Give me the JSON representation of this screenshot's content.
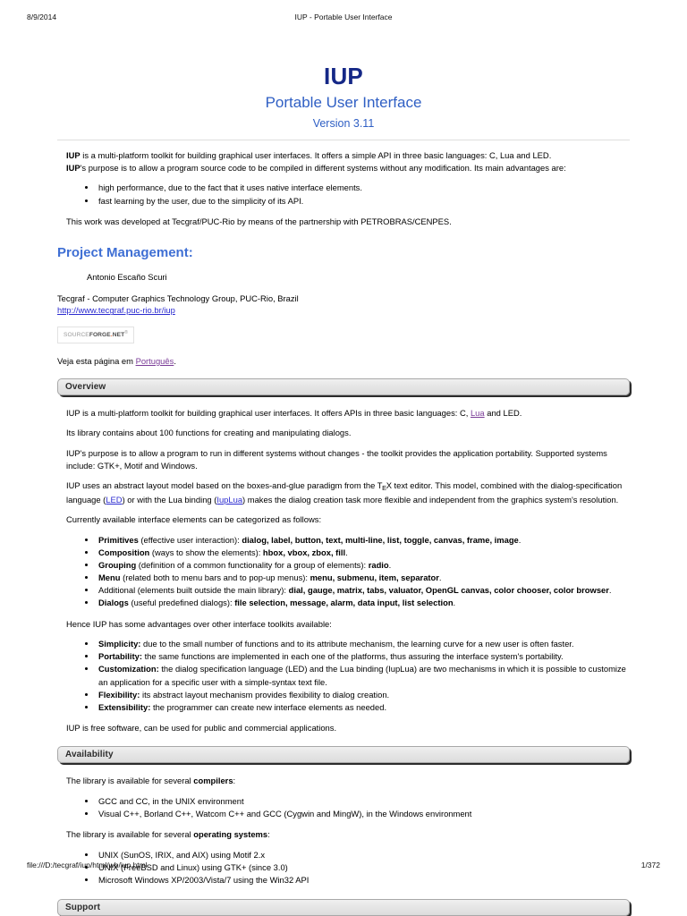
{
  "print_header": {
    "date": "8/9/2014",
    "title": "IUP - Portable User Interface"
  },
  "print_footer": {
    "url": "file:///D:/tecgraf/iup/html/wb/iup.html",
    "page": "1/372"
  },
  "title_block": {
    "title": "IUP",
    "subtitle": "Portable User Interface",
    "version": "Version 3.11",
    "title_color": "#152887",
    "subtitle_color": "#2f5fc4"
  },
  "intro": {
    "para1_bold": "IUP",
    "para1_rest": " is a multi-platform toolkit for building graphical user interfaces. It offers a simple API in three basic languages: C, Lua and LED.",
    "para2_bold": "IUP",
    "para2_rest": "'s purpose is to allow a program source code to be compiled in different systems without any modification. Its main advantages are:",
    "bullets": [
      "high performance, due to the fact that it uses native interface elements.",
      "fast learning by the user, due to the simplicity of its API."
    ],
    "closing": "This work was developed at Tecgraf/PUC-Rio by means of the partnership with PETROBRAS/CENPES."
  },
  "project_management": {
    "heading": "Project Management:",
    "person": "Antonio Escaño Scuri",
    "org": "Tecgraf - Computer Graphics Technology Group, PUC-Rio, Brazil",
    "org_link": "http://www.tecgraf.puc-rio.br/iup",
    "badge": {
      "source": "SOURCE",
      "forge": "FORGE",
      "dot": ".",
      "net": "NET",
      "tm": "®",
      "dot_color": "#f26722"
    },
    "translation_prefix": "Veja esta página em ",
    "translation_link": "Português",
    "translation_suffix": "."
  },
  "sections": [
    {
      "label": "Overview",
      "paragraphs": [
        {
          "prefix": "IUP is a multi-platform toolkit for building graphical user interfaces. It offers APIs in three basic languages: C, ",
          "link": "Lua",
          "suffix": " and LED."
        },
        {
          "text": "Its library contains about 100 functions for creating and manipulating dialogs."
        },
        {
          "text": "IUP's purpose is to allow a program to run in different systems without changes - the toolkit provides the application portability. Supported systems include: GTK+, Motif and Windows."
        },
        {
          "tex_prefix": "IUP uses an abstract layout model based on the boxes-and-glue paradigm from the T",
          "tex_sub": "E",
          "tex_mid": "X text editor. This model, combined with the dialog-specification language (",
          "link1": "LED",
          "tex_mid2": ") or with the Lua binding (",
          "link2": "IupLua",
          "tex_suffix": ") makes the dialog creation task more flexible and independent from the graphics system's resolution."
        },
        {
          "text": "Currently available interface elements can be categorized as follows:"
        }
      ],
      "element_bullets": [
        {
          "name": "Primitives",
          "name_bold": true,
          "desc": " (effective user interaction): ",
          "items": "dialog, label, button, text, multi-line, list, toggle, canvas, frame, image",
          "end": "."
        },
        {
          "name": "Composition",
          "name_bold": true,
          "desc": " (ways to show the elements): ",
          "items": "hbox, vbox, zbox, fill",
          "end": "."
        },
        {
          "name": "Grouping",
          "name_bold": true,
          "desc": " (definition of a common functionality for a group of elements): ",
          "items": "radio",
          "end": "."
        },
        {
          "name": "Menu",
          "name_bold": true,
          "desc": " (related both to menu bars and to pop-up menus): ",
          "items": "menu, submenu, item, separator",
          "end": "."
        },
        {
          "name": "Additional",
          "name_bold": false,
          "desc": " (elements built outside the main library): ",
          "items": "dial, gauge, matrix, tabs, valuator, OpenGL canvas, color chooser, color browser",
          "end": "."
        },
        {
          "name": "Dialogs",
          "name_bold": true,
          "desc": " (useful predefined dialogs): ",
          "items": "file selection, message, alarm, data input, list selection",
          "end": "."
        }
      ],
      "advantages_intro": "Hence IUP has some advantages over other interface toolkits available:",
      "advantage_bullets": [
        {
          "name": "Simplicity:",
          "desc": " due to the small number of functions and to its attribute mechanism, the learning curve for a new user is often faster."
        },
        {
          "name": "Portability:",
          "desc": " the same functions are implemented in each one of the platforms, thus assuring the interface system's portability."
        },
        {
          "name": "Customization:",
          "desc": " the dialog specification language (LED) and the Lua binding (IupLua) are two mechanisms in which it is possible to customize an application for a specific user with a simple-syntax text file."
        },
        {
          "name": "Flexibility:",
          "desc": " its abstract layout mechanism provides flexibility to dialog creation."
        },
        {
          "name": "Extensibility:",
          "desc": " the programmer can create new interface elements as needed."
        }
      ],
      "closing": "IUP is free software, can be used for public and commercial applications."
    },
    {
      "label": "Availability",
      "compilers_prefix": "The library is available for several ",
      "compilers_bold": "compilers",
      "compilers_suffix": ":",
      "compilers": [
        "GCC and CC, in the UNIX environment",
        "Visual C++, Borland C++, Watcom C++ and GCC (Cygwin and MingW), in the Windows environment"
      ],
      "os_prefix": "The library is available for several ",
      "os_bold": "operating systems",
      "os_suffix": ":",
      "operating_systems": [
        "UNIX (SunOS, IRIX, and AIX) using Motif 2.x",
        "UNIX (FreeBSD and Linux) using GTK+ (since 3.0)",
        "Microsoft Windows XP/2003/Vista/7 using the Win32 API"
      ]
    },
    {
      "label": "Support"
    }
  ]
}
